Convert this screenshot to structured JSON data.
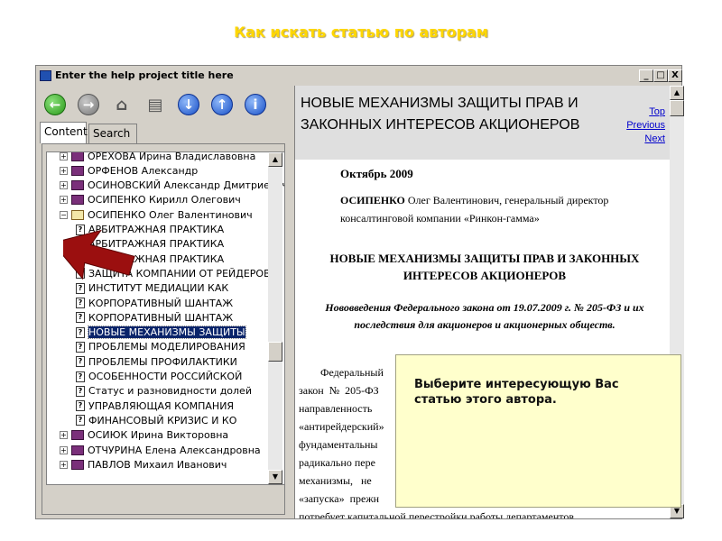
{
  "slide": {
    "title": "Как искать статью по авторам"
  },
  "window": {
    "title": "Enter the help project title here",
    "controls": {
      "minimize": "_",
      "maximize": "□",
      "close": "X"
    }
  },
  "toolbar": [
    {
      "name": "back-button",
      "icon": "green-left-arrow",
      "glyph": "←",
      "style": "g"
    },
    {
      "name": "forward-button",
      "icon": "gray-right-arrow",
      "glyph": "→",
      "style": "gr"
    },
    {
      "name": "home-button",
      "icon": "house-icon",
      "glyph": "⌂",
      "style": "plain"
    },
    {
      "name": "print-button",
      "icon": "printer-icon",
      "glyph": "▤",
      "style": "plain"
    },
    {
      "name": "down-button",
      "icon": "blue-down-arrow",
      "glyph": "↓",
      "style": "b"
    },
    {
      "name": "up-button",
      "icon": "blue-up-arrow",
      "glyph": "↑",
      "style": "b"
    },
    {
      "name": "info-button",
      "icon": "blue-info-icon",
      "glyph": "i",
      "style": "b"
    }
  ],
  "tabs": [
    {
      "label": "Content",
      "active": true
    },
    {
      "label": "Search",
      "active": false
    }
  ],
  "tree": [
    {
      "type": "book",
      "label": "ОРЕХОВА Ирина Владиславовна",
      "expanded": false
    },
    {
      "type": "book",
      "label": "ОРФЕНОВ Александр",
      "expanded": false
    },
    {
      "type": "book",
      "label": "ОСИНОВСКИЙ Александр Дмитриевич",
      "expanded": false
    },
    {
      "type": "book",
      "label": "ОСИПЕНКО Кирилл Олегович",
      "expanded": false
    },
    {
      "type": "book",
      "label": "ОСИПЕНКО Олег Валентинович",
      "expanded": true
    },
    {
      "type": "page",
      "label": "АРБИТРАЖНАЯ ПРАКТИКА"
    },
    {
      "type": "page",
      "label": "АРБИТРАЖНАЯ ПРАКТИКА"
    },
    {
      "type": "page",
      "label": "АРБИТРАЖНАЯ ПРАКТИКА"
    },
    {
      "type": "page",
      "label": "ЗАЩИТА КОМПАНИИ ОТ РЕЙДЕРОВ"
    },
    {
      "type": "page",
      "label": "ИНСТИТУТ МЕДИАЦИИ КАК"
    },
    {
      "type": "page",
      "label": "КОРПОРАТИВНЫЙ ШАНТАЖ"
    },
    {
      "type": "page",
      "label": "КОРПОРАТИВНЫЙ ШАНТАЖ"
    },
    {
      "type": "page",
      "label": "НОВЫЕ МЕХАНИЗМЫ ЗАЩИТЫ",
      "selected": true
    },
    {
      "type": "page",
      "label": "ПРОБЛЕМЫ МОДЕЛИРОВАНИЯ"
    },
    {
      "type": "page",
      "label": "ПРОБЛЕМЫ ПРОФИЛАКТИКИ"
    },
    {
      "type": "page",
      "label": "ОСОБЕННОСТИ РОССИЙСКОЙ"
    },
    {
      "type": "page",
      "label": "Статус и разновидности долей"
    },
    {
      "type": "page",
      "label": "УПРАВЛЯЮЩАЯ КОМПАНИЯ"
    },
    {
      "type": "page",
      "label": "ФИНАНСОВЫЙ КРИЗИС И КО"
    },
    {
      "type": "book",
      "label": "ОСИЮК Ирина Викторовна",
      "expanded": false
    },
    {
      "type": "book",
      "label": "ОТЧУРИНА Елена Александровна",
      "expanded": false
    },
    {
      "type": "book",
      "label": "ПАВЛОВ Михаил Иванович",
      "expanded": false
    }
  ],
  "topic": {
    "title": "НОВЫЕ МЕХАНИЗМЫ ЗАЩИТЫ ПРАВ И ЗАКОННЫХ ИНТЕРЕСОВ АКЦИОНЕРОВ",
    "links": [
      "Top",
      "Previous",
      "Next"
    ],
    "date": "Октябрь 2009",
    "author_name": "ОСИПЕНКО",
    "author_rest": " Олег Валентинович, генеральный директор консалтинговой компании «Ринкон-гамма»",
    "doc_title": "НОВЫЕ МЕХАНИЗМЫ ЗАЩИТЫ ПРАВ И ЗАКОННЫХ ИНТЕРЕСОВ АКЦИОНЕРОВ",
    "subheading": "Нововведения Федерального закона от 19.07.2009 г. № 205-ФЗ и их последствия для акционеров и акционерных обществ.",
    "body_lines": [
      "        Федеральный",
      "закон  №  205-ФЗ",
      "направленность",
      "«антирейдерский»",
      "фундаментальны",
      "радикально пере",
      "механизмы,   не",
      "«запуска»  прежн",
      "потребует капитальной перестройки работы департаментов"
    ]
  },
  "callout": {
    "text": "Выберите интересующую Вас статью этого автора."
  }
}
